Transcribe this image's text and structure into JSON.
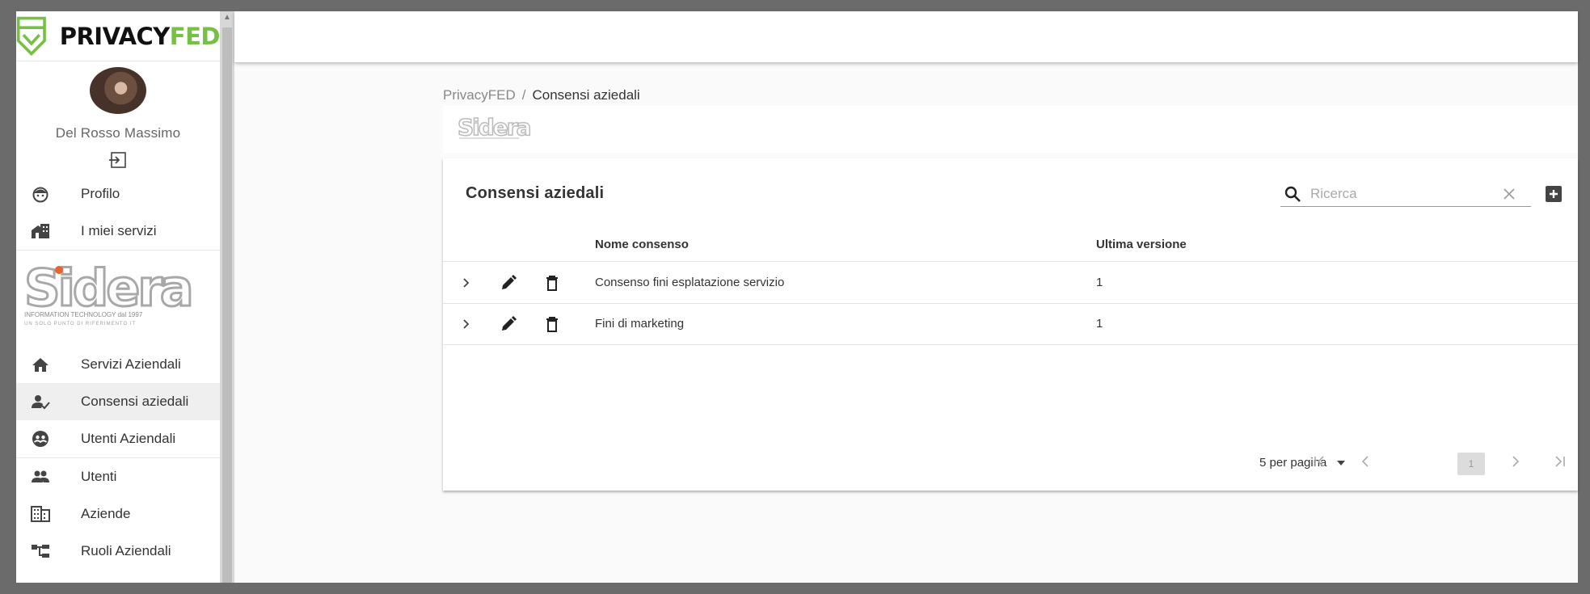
{
  "brand": {
    "name_main": "PRIVACY",
    "name_accent": "FED",
    "accent_color": "#76c043"
  },
  "user": {
    "name": "Del Rosso Massimo"
  },
  "sidebar": {
    "top_items": [
      {
        "label": "Profilo",
        "icon": "face-icon"
      },
      {
        "label": "I miei servizi",
        "icon": "services-icon"
      }
    ],
    "company_logo": {
      "name": "Sidera",
      "tagline": "INFORMATION TECHNOLOGY dal 1997",
      "subtagline": "UN SOLO PUNTO DI RIFERIMENTO IT"
    },
    "company_items": [
      {
        "label": "Servizi Aziendali",
        "icon": "home-icon"
      },
      {
        "label": "Consensi aziedali",
        "icon": "person-check-icon",
        "active": true
      },
      {
        "label": "Utenti Aziendali",
        "icon": "group-circle-icon"
      }
    ],
    "admin_items": [
      {
        "label": "Utenti",
        "icon": "people-icon"
      },
      {
        "label": "Aziende",
        "icon": "building-icon"
      },
      {
        "label": "Ruoli Aziendali",
        "icon": "hierarchy-icon"
      }
    ]
  },
  "breadcrumb": {
    "root": "PrivacyFED",
    "separator": "/",
    "current": "Consensi aziedali"
  },
  "card": {
    "title": "Consensi aziedali",
    "search_placeholder": "Ricerca",
    "columns": [
      "Nome consenso",
      "Ultima versione"
    ],
    "rows": [
      {
        "name": "Consenso fini esplatazione servizio",
        "version": "1"
      },
      {
        "name": "Fini di marketing",
        "version": "1"
      }
    ],
    "pager": {
      "page_size_label": "5 per pagina",
      "current_page": "1"
    }
  }
}
